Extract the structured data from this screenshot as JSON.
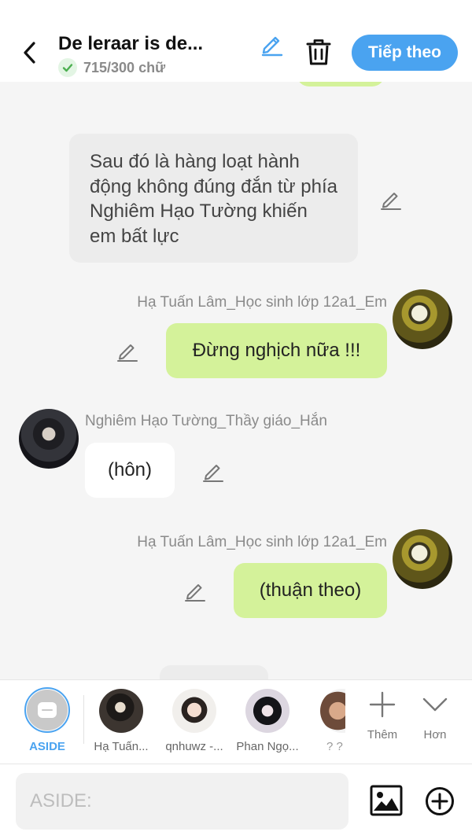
{
  "header": {
    "title": "De leraar is de...",
    "word_count": "715/300 chữ",
    "next_label": "Tiếp theo"
  },
  "chat": {
    "messages": [
      {
        "type": "narration",
        "text": "Sau đó là hàng loạt hành động không đúng đắn từ phía Nghiêm Hạo Tường khiến em bất lực"
      },
      {
        "type": "right",
        "sender": "Hạ Tuấn Lâm_Học sinh lớp 12a1_Em",
        "text": "Đừng nghịch nữa !!!"
      },
      {
        "type": "left",
        "sender": "Nghiêm Hạo Tường_Thầy giáo_Hắn",
        "text": "(hôn)"
      },
      {
        "type": "right",
        "sender": "Hạ Tuấn Lâm_Học sinh lớp 12a1_Em",
        "text": "(thuận theo)"
      }
    ]
  },
  "characters": [
    {
      "label": "ASIDE",
      "selected": true
    },
    {
      "label": "Hạ Tuấn..."
    },
    {
      "label": "qnhuwz -..."
    },
    {
      "label": "Phan Ngọ..."
    },
    {
      "label": "? ?"
    }
  ],
  "tools": {
    "add_label": "Thêm",
    "more_label": "Hơn"
  },
  "input": {
    "placeholder": "ASIDE:",
    "value": ""
  },
  "colors": {
    "accent": "#4aa3f0",
    "bubble_green": "#d4f29a",
    "check_green": "#4caf50"
  }
}
